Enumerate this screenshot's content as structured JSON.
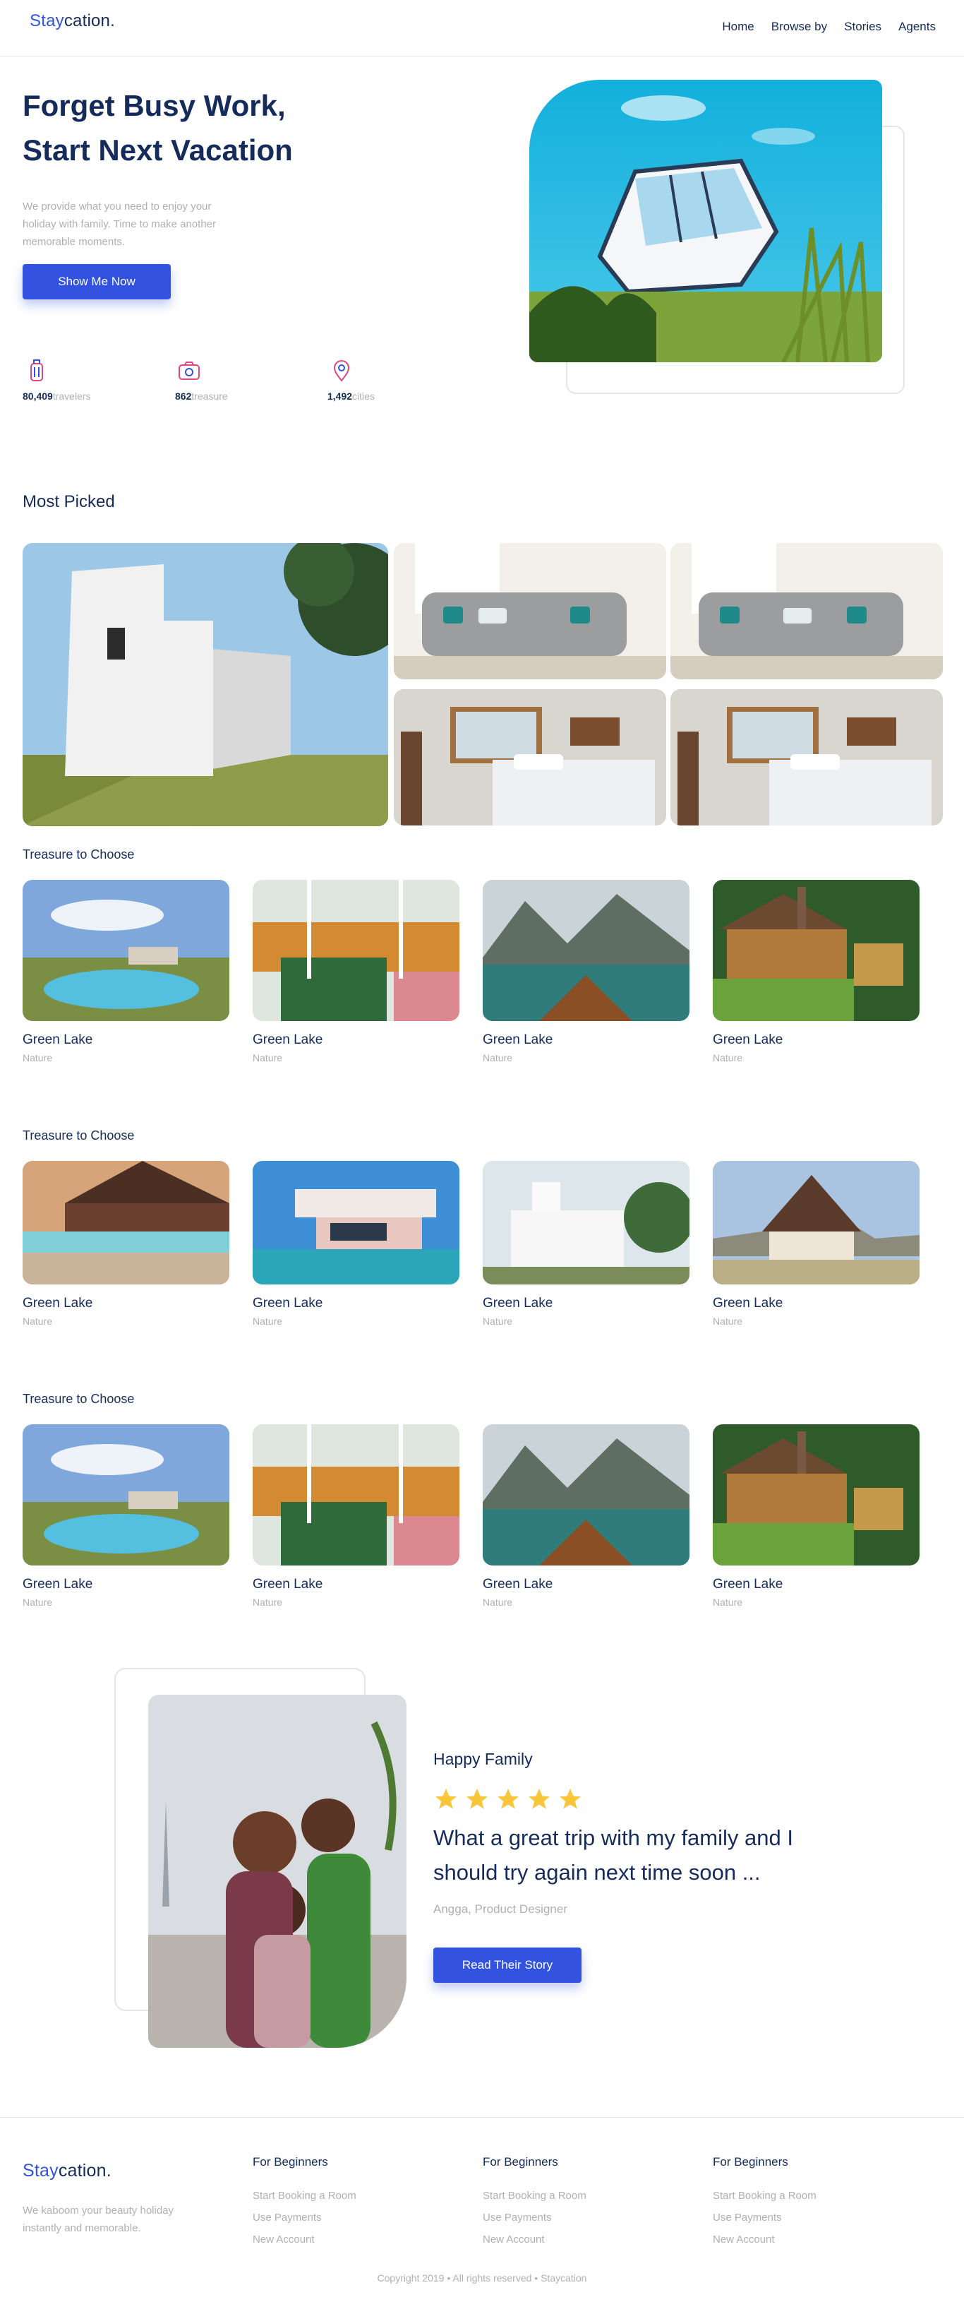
{
  "brand": {
    "part1": "Stay",
    "part2": "cation."
  },
  "nav": [
    "Home",
    "Browse by",
    "Stories",
    "Agents"
  ],
  "hero": {
    "title_line1": "Forget Busy Work,",
    "title_line2": "Start Next Vacation",
    "description": "We provide what you need to enjoy your holiday with family. Time to make another memorable moments.",
    "cta": "Show Me Now",
    "stats": [
      {
        "value": "80,409",
        "label": "travelers",
        "icon": "suitcase-icon"
      },
      {
        "value": "862",
        "label": "treasure",
        "icon": "camera-icon"
      },
      {
        "value": "1,492",
        "label": "cities",
        "icon": "map-pin-icon"
      }
    ]
  },
  "most_picked": {
    "title": "Most Picked"
  },
  "categories": [
    {
      "title": "Treasure to Choose",
      "items": [
        {
          "name": "Green Lake",
          "location": "Nature"
        },
        {
          "name": "Green Lake",
          "location": "Nature"
        },
        {
          "name": "Green Lake",
          "location": "Nature"
        },
        {
          "name": "Green Lake",
          "location": "Nature"
        }
      ]
    },
    {
      "title": "Treasure to Choose",
      "items": [
        {
          "name": "Green Lake",
          "location": "Nature"
        },
        {
          "name": "Green Lake",
          "location": "Nature"
        },
        {
          "name": "Green Lake",
          "location": "Nature"
        },
        {
          "name": "Green Lake",
          "location": "Nature"
        }
      ]
    },
    {
      "title": "Treasure to Choose",
      "items": [
        {
          "name": "Green Lake",
          "location": "Nature"
        },
        {
          "name": "Green Lake",
          "location": "Nature"
        },
        {
          "name": "Green Lake",
          "location": "Nature"
        },
        {
          "name": "Green Lake",
          "location": "Nature"
        }
      ]
    }
  ],
  "testimonial": {
    "title": "Happy Family",
    "rating": 5,
    "quote": "What a great trip with my family and I should try again next time soon ...",
    "author": "Angga, Product Designer",
    "cta": "Read Their Story"
  },
  "footer": {
    "description": "We kaboom your beauty holiday instantly and memorable.",
    "columns": [
      {
        "title": "For Beginners",
        "links": [
          "Start Booking a Room",
          "Use Payments",
          "New Account"
        ]
      },
      {
        "title": "For Beginners",
        "links": [
          "Start Booking a Room",
          "Use Payments",
          "New Account"
        ]
      },
      {
        "title": "For Beginners",
        "links": [
          "Start Booking a Room",
          "Use Payments",
          "New Account"
        ]
      }
    ],
    "copyright": "Copyright 2019 • All rights reserved • Staycation"
  },
  "colors": {
    "primary": "#3252df",
    "dark": "#152c5b",
    "muted": "#b0b0b0",
    "star": "#f8c63a"
  }
}
